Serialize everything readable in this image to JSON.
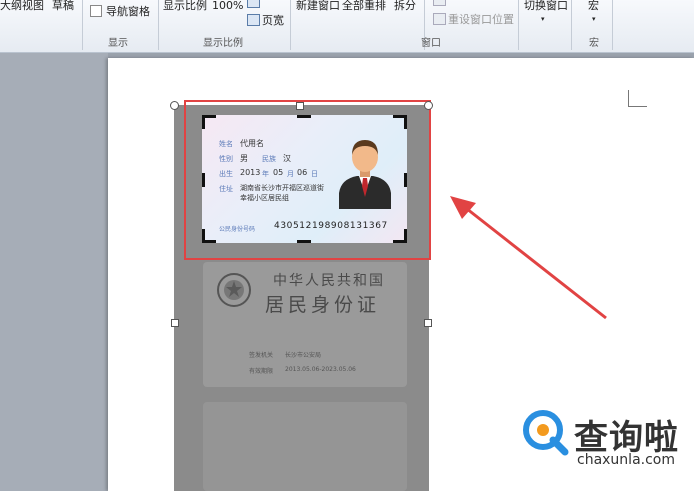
{
  "ribbon": {
    "items": {
      "outline_view": "大纲视图",
      "draft": "草稿",
      "nav_pane": "导航窗格",
      "zoom": "显示比例",
      "zoom_100": "100%",
      "one_page": "页宽",
      "new_window": "新建窗口",
      "arrange_all": "全部重排",
      "split": "拆分",
      "reset_window_pos": "重设窗口位置",
      "switch_windows": "切换窗口",
      "macros": "宏"
    },
    "group_labels": {
      "show": "显示",
      "zoom": "显示比例",
      "window": "窗口",
      "macros": "宏"
    }
  },
  "id_card": {
    "name_label": "姓名",
    "name_value": "代用名",
    "sex_label": "性别",
    "sex_value": "男",
    "ethnic_label": "民族",
    "ethnic_value": "汉",
    "birth_label": "出生",
    "birth_year": "2013",
    "birth_year_unit": "年",
    "birth_month": "05",
    "birth_month_unit": "月",
    "birth_day": "06",
    "birth_day_unit": "日",
    "address_label": "住址",
    "address_line1": "湖南省长沙市开福区巡道街",
    "address_line2": "幸福小区居民组",
    "id_label": "公民身份号码",
    "id_number": "430512198908131367"
  },
  "id_back": {
    "country": "中华人民共和国",
    "title": "居民身份证",
    "authority_label": "签发机关",
    "authority_value": "长沙市公安局",
    "valid_label": "有效期限",
    "valid_value": "2013.05.06-2023.05.06"
  },
  "watermark": {
    "brand": "查询啦",
    "url": "chaxunla.com"
  },
  "colors": {
    "annotation_red": "#e14343",
    "brand_blue": "#2a8fe0",
    "brand_orange": "#f39a1e"
  }
}
